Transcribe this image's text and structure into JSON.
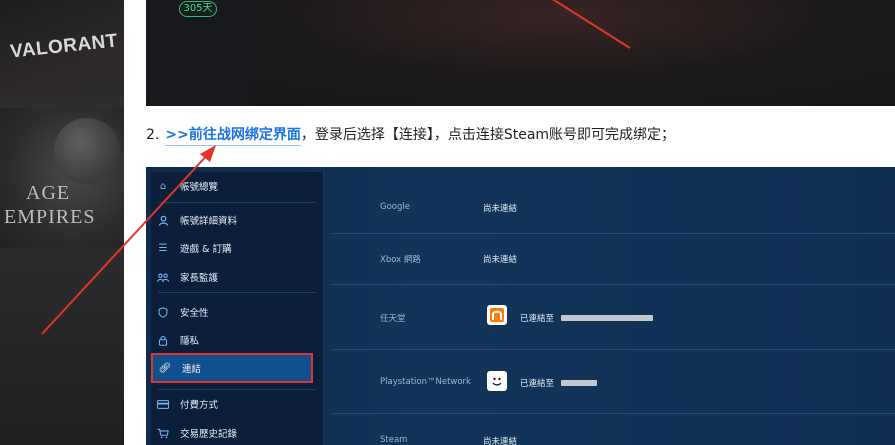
{
  "background": {
    "valorant_logo": "VALORANT",
    "aoe_logo_line1": "AGE",
    "aoe_logo_line2": "EMPIRES"
  },
  "top_screenshot": {
    "days_badge": "305天"
  },
  "step": {
    "number": "2.",
    "link_text": ">>前往战网绑定界面",
    "rest_text": "，登录后选择【连接】，点击连接Steam账号即可完成绑定；"
  },
  "account_page": {
    "sidebar": {
      "items": [
        {
          "label": "帳號總覽",
          "icon": "home-icon"
        },
        {
          "label": "帳號詳細資料",
          "icon": "user-icon"
        },
        {
          "label": "遊戲 & 訂購",
          "icon": "list-icon"
        },
        {
          "label": "家長監護",
          "icon": "family-icon"
        },
        {
          "label": "安全性",
          "icon": "shield-icon"
        },
        {
          "label": "隱私",
          "icon": "lock-icon"
        },
        {
          "label": "連結",
          "icon": "link-icon"
        },
        {
          "label": "付費方式",
          "icon": "card-icon"
        },
        {
          "label": "交易歷史記錄",
          "icon": "cart-icon"
        }
      ],
      "active": "連結"
    },
    "connections": [
      {
        "service": "Google",
        "status": "尚未連結"
      },
      {
        "service": "Xbox 網路",
        "status": "尚未連結"
      },
      {
        "service": "任天堂",
        "status": "已連結至"
      },
      {
        "service": "Playstation™Network",
        "status": "已連結至"
      },
      {
        "service": "Steam",
        "status": "尚未連結"
      }
    ]
  },
  "colors": {
    "link": "#1a73e8",
    "highlight_border": "#e0352b",
    "arrow": "#e0352b",
    "nav_bg": "#0b1f3a",
    "page_bg": "#113559"
  }
}
